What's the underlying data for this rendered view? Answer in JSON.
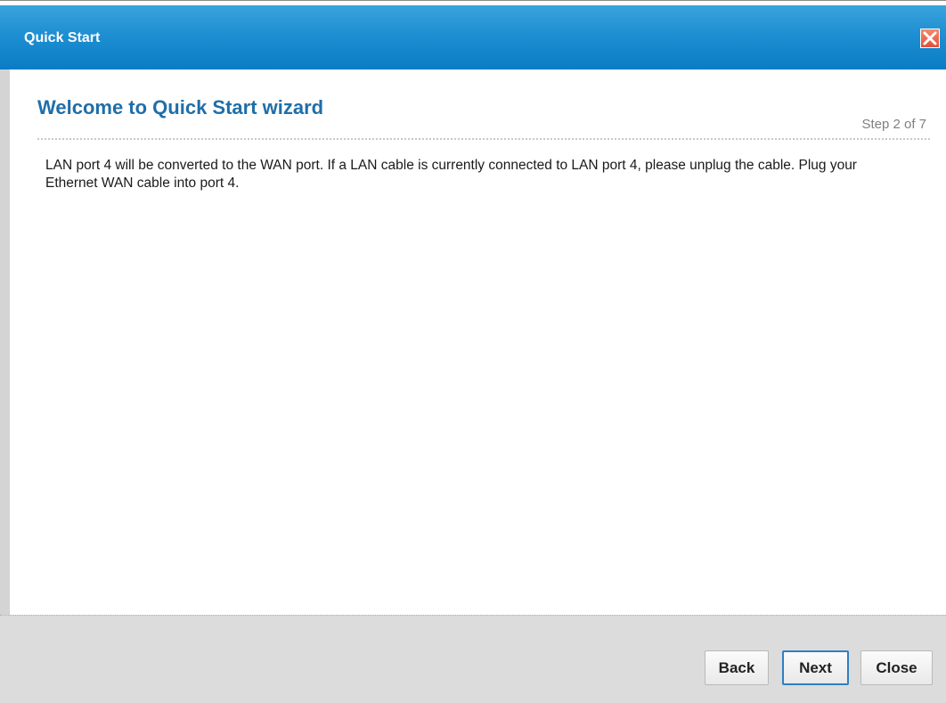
{
  "window": {
    "title": "Quick Start"
  },
  "wizard": {
    "heading": "Welcome to Quick Start wizard",
    "step": "Step 2 of 7",
    "message": "LAN port 4 will be converted to the WAN port. If a LAN cable is currently connected to LAN port 4, please unplug the cable. Plug your Ethernet WAN cable into port 4."
  },
  "footer": {
    "back_label": "Back",
    "next_label": "Next",
    "close_label": "Close"
  },
  "colors": {
    "titlebar": "#1e8fd2",
    "heading": "#1f6ea8",
    "close_icon": "#e2503a",
    "primary_button_border": "#2f7fc1"
  },
  "icons": {
    "close": "close-icon"
  }
}
